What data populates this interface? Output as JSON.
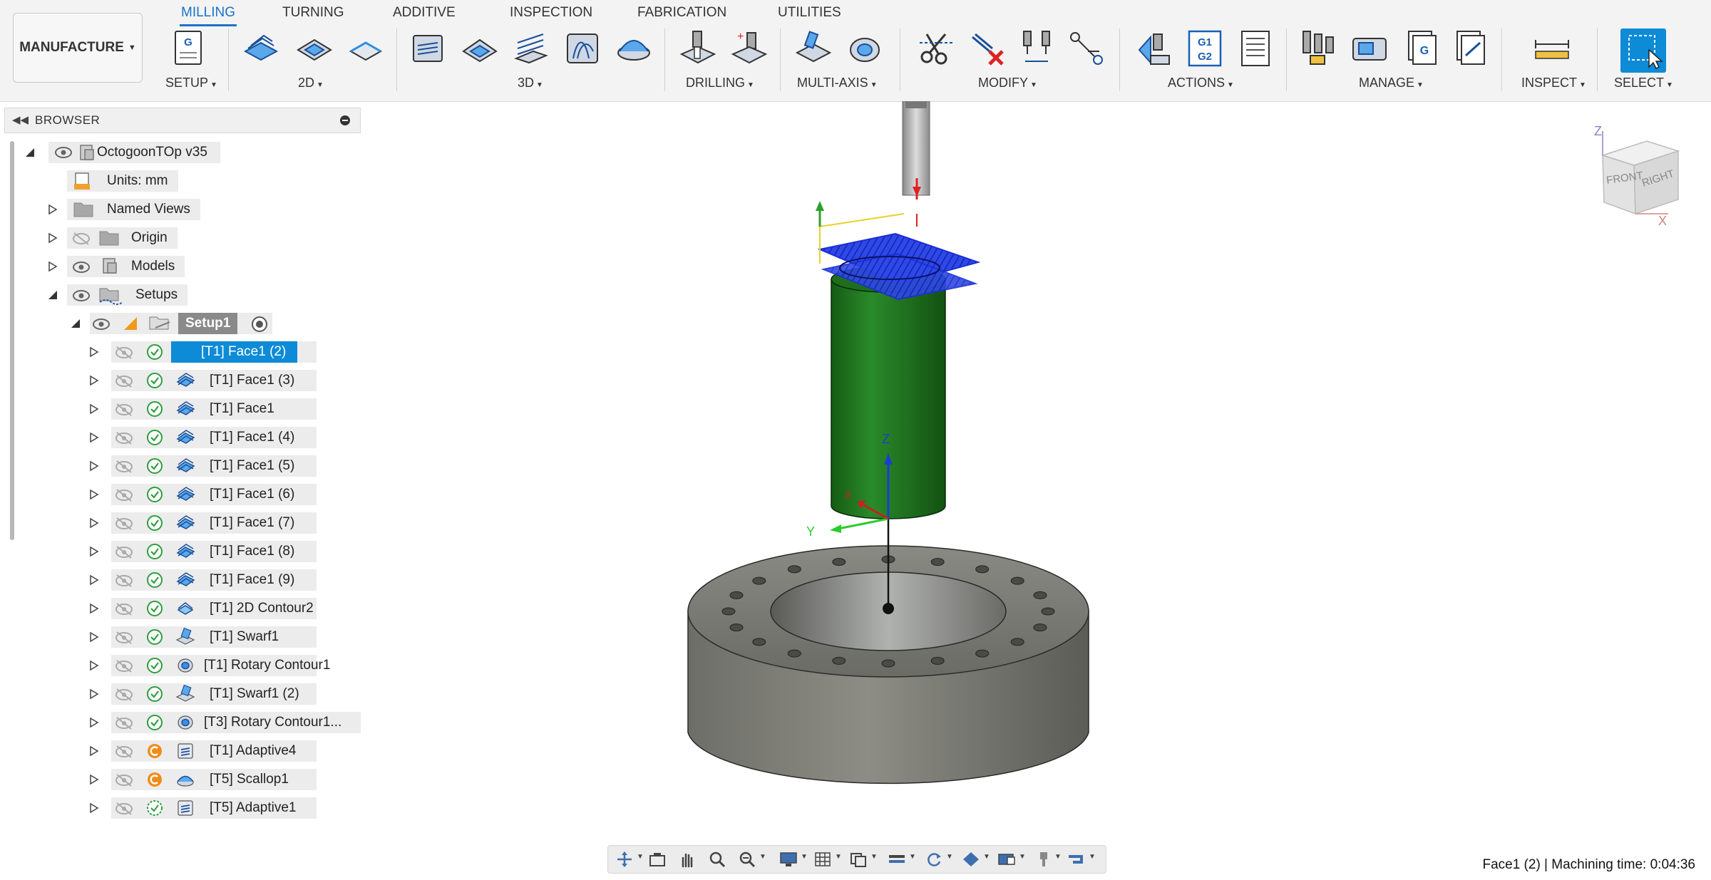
{
  "workspace": {
    "label": "MANUFACTURE"
  },
  "tabs": [
    {
      "label": "MILLING",
      "active": true
    },
    {
      "label": "TURNING"
    },
    {
      "label": "ADDITIVE"
    },
    {
      "label": "INSPECTION"
    },
    {
      "label": "FABRICATION"
    },
    {
      "label": "UTILITIES"
    }
  ],
  "groups": {
    "setup": "SETUP",
    "twod": "2D",
    "threed": "3D",
    "drilling": "DRILLING",
    "multiaxis": "MULTI-AXIS",
    "modify": "MODIFY",
    "actions": "ACTIONS",
    "manage": "MANAGE",
    "inspect": "INSPECT",
    "select": "SELECT"
  },
  "toolbar_text": {
    "setup_g": "G",
    "actions_g1": "G1",
    "actions_g2": "G2",
    "manage_g": "G"
  },
  "browser": {
    "title": "BROWSER",
    "root": "OctogoonTOp v35",
    "units": "Units: mm",
    "named_views": "Named Views",
    "origin": "Origin",
    "models": "Models",
    "setups": "Setups",
    "setup1": "Setup1",
    "operations": [
      {
        "label": "[T1] Face1 (2)",
        "status": "ok",
        "icon": "face-icon",
        "selected": true
      },
      {
        "label": "[T1] Face1 (3)",
        "status": "ok",
        "icon": "face-icon"
      },
      {
        "label": "[T1] Face1",
        "status": "ok",
        "icon": "face-icon"
      },
      {
        "label": "[T1] Face1 (4)",
        "status": "ok",
        "icon": "face-icon"
      },
      {
        "label": "[T1] Face1 (5)",
        "status": "ok",
        "icon": "face-icon"
      },
      {
        "label": "[T1] Face1 (6)",
        "status": "ok",
        "icon": "face-icon"
      },
      {
        "label": "[T1] Face1 (7)",
        "status": "ok",
        "icon": "face-icon"
      },
      {
        "label": "[T1] Face1 (8)",
        "status": "ok",
        "icon": "face-icon"
      },
      {
        "label": "[T1] Face1 (9)",
        "status": "ok",
        "icon": "face-icon"
      },
      {
        "label": "[T1] 2D Contour2",
        "status": "ok",
        "icon": "contour-icon"
      },
      {
        "label": "[T1] Swarf1",
        "status": "ok",
        "icon": "swarf-icon"
      },
      {
        "label": "[T1] Rotary Contour1",
        "status": "ok",
        "icon": "rotary-icon"
      },
      {
        "label": "[T1] Swarf1 (2)",
        "status": "ok",
        "icon": "swarf-icon"
      },
      {
        "label": "[T3] Rotary Contour1...",
        "status": "ok",
        "icon": "rotary-icon"
      },
      {
        "label": "[T1] Adaptive4",
        "status": "warn",
        "icon": "adaptive-icon"
      },
      {
        "label": "[T5] Scallop1",
        "status": "warn",
        "icon": "scallop-icon"
      },
      {
        "label": "[T5] Adaptive1",
        "status": "dashed",
        "icon": "adaptive-icon"
      }
    ]
  },
  "viewport": {
    "axis_x": "X",
    "axis_y": "Y",
    "axis_z": "Z",
    "cube_front": "FRONT",
    "cube_right": "RIGHT",
    "cube_z": "Z",
    "cube_x": "X"
  },
  "status": {
    "text": "Face1 (2) | Machining time: 0:04:36"
  },
  "colors": {
    "accent": "#0d8bd6",
    "tab_active": "#1a73c8",
    "stock_green": "#1f7a1f",
    "toolpath_blue": "#1a2fd6",
    "part_gray": "#7a7a74",
    "ok_green": "#2e9e3e",
    "warn_orange": "#f08c1a"
  }
}
